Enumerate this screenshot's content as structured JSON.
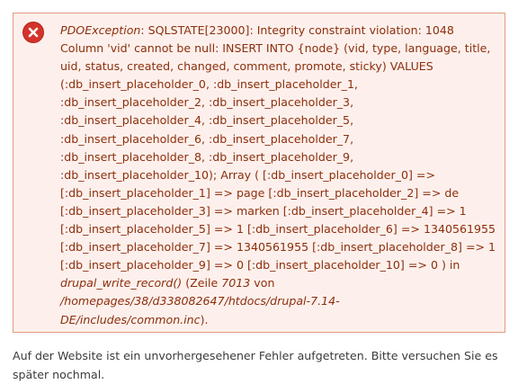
{
  "error": {
    "icon": "error-cross-icon",
    "color_text": "#8c2e0b",
    "color_border": "#e59a80",
    "color_background": "#fdf0ec",
    "exception_type": "PDOException",
    "lines": [
      ": SQLSTATE[23000]: Integrity constraint violation: 1048",
      "Column 'vid' cannot be null: INSERT INTO {node} (vid, type, language, title,",
      "uid, status, created, changed, comment, promote, sticky) VALUES",
      "(:db_insert_placeholder_0, :db_insert_placeholder_1,",
      ":db_insert_placeholder_2, :db_insert_placeholder_3,",
      ":db_insert_placeholder_4, :db_insert_placeholder_5,",
      ":db_insert_placeholder_6, :db_insert_placeholder_7,",
      ":db_insert_placeholder_8, :db_insert_placeholder_9,",
      ":db_insert_placeholder_10); Array ( [:db_insert_placeholder_0] =>",
      "[:db_insert_placeholder_1] => page [:db_insert_placeholder_2] => de",
      "[:db_insert_placeholder_3] => marken [:db_insert_placeholder_4] => 1",
      "[:db_insert_placeholder_5] => 1 [:db_insert_placeholder_6] => 1340561955",
      "[:db_insert_placeholder_7] => 1340561955 [:db_insert_placeholder_8] => 1",
      "[:db_insert_placeholder_9] => 0 [:db_insert_placeholder_10] => 0 ) in"
    ],
    "function": "drupal_write_record()",
    "zeile_prefix": " (Zeile ",
    "line_number": "7013",
    "von": " von",
    "path_part1": "/homepages/38/d338082647/htdocs/drupal-7.14-",
    "path_part2": "DE/includes/common.inc",
    "closing": ")."
  },
  "message": {
    "line1": "Auf der Website ist ein unvorhergesehener Fehler aufgetreten. Bitte versuchen Sie es",
    "line2": "später nochmal."
  }
}
